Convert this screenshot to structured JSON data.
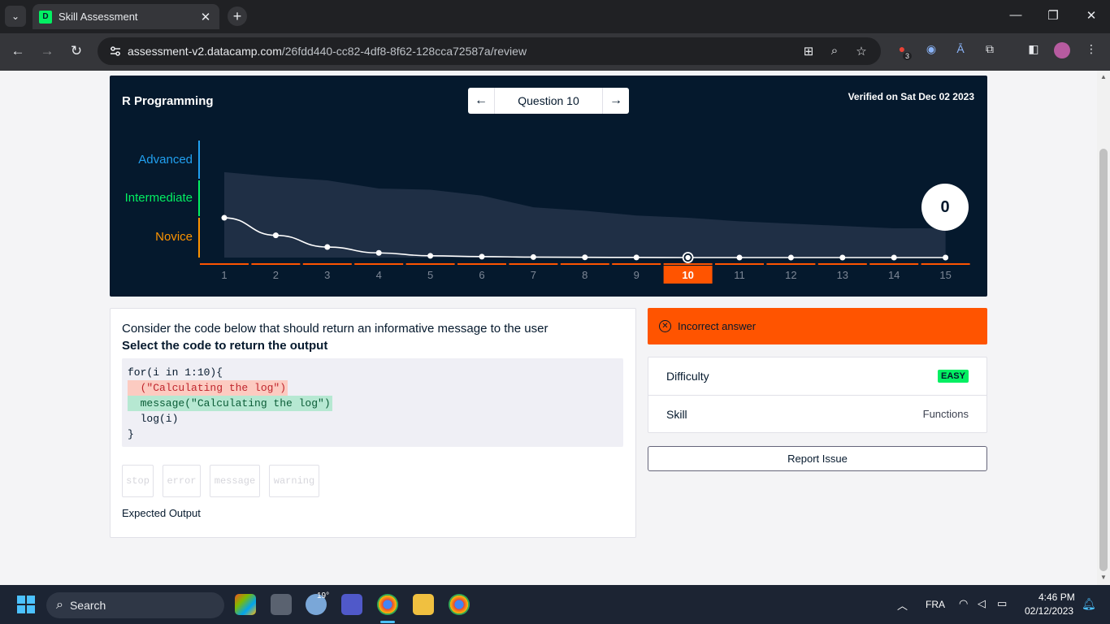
{
  "browser": {
    "tab_title": "Skill Assessment",
    "url_host": "assessment-v2.datacamp.com",
    "url_path": "/26fdd440-cc82-4df8-8f62-128cca72587a/review",
    "extension_badge": "3"
  },
  "assessment": {
    "title": "R Programming",
    "question_label": "Question 10",
    "verified": "Verified on Sat Dec 02 2023",
    "levels": [
      "Advanced",
      "Intermediate",
      "Novice"
    ],
    "level_colors": [
      "#21a0f0",
      "#03ef62",
      "#ff9400"
    ],
    "score": "0",
    "current_question": 10
  },
  "chart_data": {
    "type": "line",
    "x": [
      1,
      2,
      3,
      4,
      5,
      6,
      7,
      8,
      9,
      10,
      11,
      12,
      13,
      14,
      15
    ],
    "x_tick_labels": [
      "1",
      "2",
      "3",
      "4",
      "5",
      "6",
      "7",
      "8",
      "9",
      "10",
      "11",
      "12",
      "13",
      "14",
      "15"
    ],
    "series": [
      {
        "values": [
          0.34,
          0.19,
          0.09,
          0.04,
          0.015,
          0.008,
          0.004,
          0.002,
          0.001,
          0.0,
          0.0,
          0.0,
          0.0,
          0.0,
          0.0
        ]
      }
    ],
    "band_upper": [
      0.73,
      0.69,
      0.66,
      0.59,
      0.58,
      0.53,
      0.43,
      0.4,
      0.36,
      0.34,
      0.31,
      0.29,
      0.27,
      0.25,
      0.25
    ],
    "highlight_x": 10,
    "ylim": [
      0,
      1
    ]
  },
  "question": {
    "prompt": "Consider the code below that should return an informative message to the user",
    "instruction": "Select the code to return the output",
    "code": {
      "line1": "for(i in 1:10){",
      "line2_removed": "  (\"Calculating the log\")",
      "line3_added": "  message(\"Calculating the log\")",
      "line4": "  log(i)",
      "line5": "}"
    },
    "options": [
      "stop",
      "error",
      "message",
      "warning"
    ],
    "expected_output": "Expected Output"
  },
  "result": {
    "status": "Incorrect answer",
    "status_color": "#ff5400",
    "difficulty_label": "Difficulty",
    "difficulty_value": "EASY",
    "skill_label": "Skill",
    "skill_value": "Functions",
    "report_label": "Report Issue"
  },
  "taskbar": {
    "search": "Search",
    "weather": "19°",
    "language": "FRA",
    "time": "4:46 PM",
    "date": "02/12/2023"
  }
}
